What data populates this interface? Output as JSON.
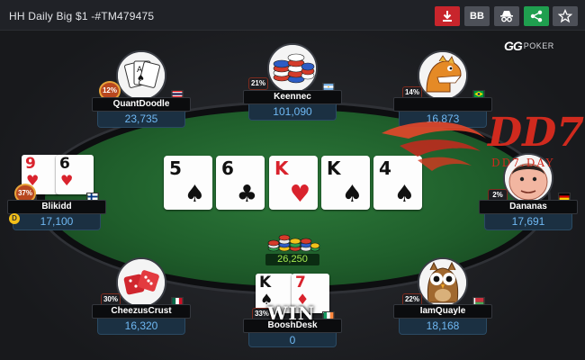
{
  "header": {
    "title": "HH Daily Big $1 -#TM479475",
    "bb_label": "BB",
    "colors": {
      "download": "#c8252c",
      "share": "#1f9f4f",
      "neutral": "#4d5058"
    }
  },
  "brand": {
    "gg": "GG",
    "poker": "POKER"
  },
  "board": [
    {
      "rank": "5",
      "suit": "♠",
      "color": "black"
    },
    {
      "rank": "6",
      "suit": "♣",
      "color": "black"
    },
    {
      "rank": "K",
      "suit": "♥",
      "color": "red"
    },
    {
      "rank": "K",
      "suit": "♠",
      "color": "black"
    },
    {
      "rank": "4",
      "suit": "♠",
      "color": "black"
    }
  ],
  "pot": "26,250",
  "dealer_label": "D",
  "win_label": "WIN",
  "players": [
    {
      "name": "QuantDoodle",
      "stack": "23,735",
      "pct": "12%",
      "avatar": "playing-cards-avatar",
      "flag": "thailand"
    },
    {
      "name": "Keennec",
      "stack": "101,090",
      "pct": "21%",
      "avatar": "poker-chips-avatar",
      "flag": "argentina"
    },
    {
      "name": "",
      "stack": "16,873",
      "pct": "14%",
      "avatar": "dinosaur-avatar",
      "flag": "brazil"
    },
    {
      "name": "Blikidd",
      "stack": "17,100",
      "pct": "37%",
      "avatar": "hole-cards",
      "flag": "finland",
      "hole_cards": [
        {
          "rank": "9",
          "suit": "♥",
          "color": "red"
        },
        {
          "rank": "6",
          "suit": "♥",
          "color": "red"
        }
      ]
    },
    {
      "name": "Dananas",
      "stack": "17,691",
      "pct": "2%",
      "avatar": "man-face-avatar",
      "flag": "germany"
    },
    {
      "name": "CheezusCrust",
      "stack": "16,320",
      "pct": "30%",
      "avatar": "red-dice-avatar",
      "flag": "mexico"
    },
    {
      "name": "BooshDesk",
      "stack": "0",
      "pct": "33%",
      "avatar": "hole-cards",
      "flag": "ireland",
      "hole_cards": [
        {
          "rank": "K",
          "suit": "♠",
          "color": "black"
        },
        {
          "rank": "7",
          "suit": "♦",
          "color": "red"
        }
      ]
    },
    {
      "name": "IamQuayle",
      "stack": "18,168",
      "pct": "22%",
      "avatar": "owl-avatar",
      "flag": "belarus"
    }
  ],
  "watermark": {
    "main": "DD7",
    "sub": "DD7.DAY"
  }
}
